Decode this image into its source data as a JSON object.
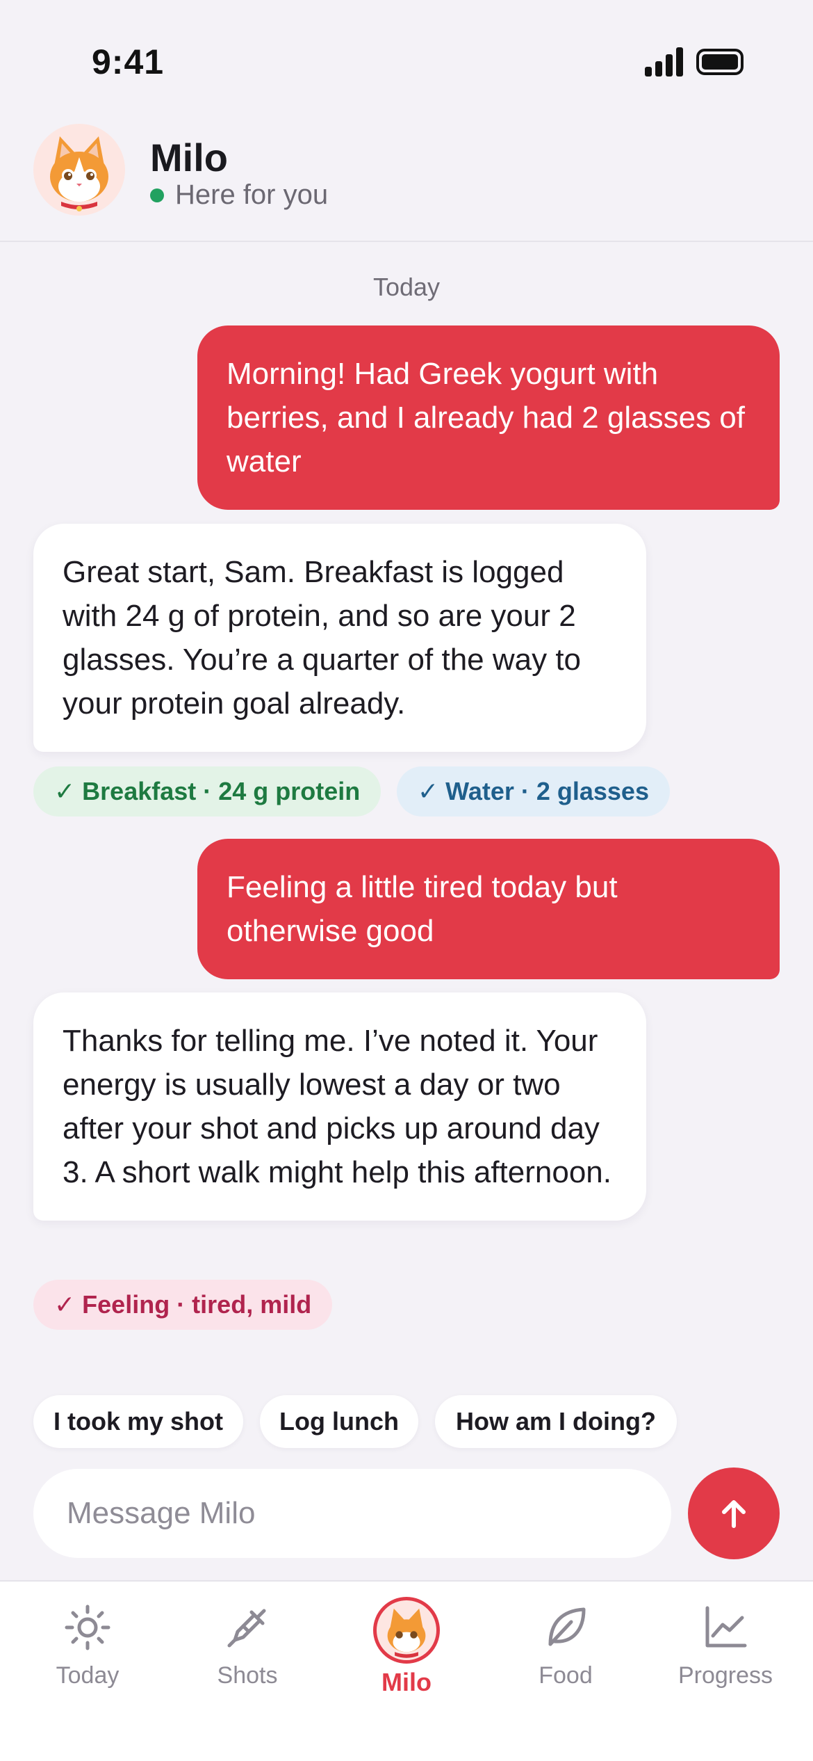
{
  "status_bar": {
    "time": "9:41"
  },
  "header": {
    "name": "Milo",
    "status": "Here for you"
  },
  "conversation": {
    "date_label": "Today",
    "messages": [
      {
        "role": "user",
        "text": "Morning! Had Greek yogurt with berries, and I already had 2 glasses of water"
      },
      {
        "role": "assistant",
        "text": "Great start, Sam. Breakfast is logged with 24 g of protein, and so are your 2 glasses. You’re a quarter of the way to your protein goal already."
      },
      {
        "role": "user",
        "text": "Feeling a little tired today but otherwise good"
      },
      {
        "role": "assistant",
        "text": "Thanks for telling me. I’ve noted it. Your energy is usually lowest a day or two after your shot and picks up around day 3. A short walk might help this afternoon."
      }
    ],
    "log_chips": [
      {
        "check": "✓",
        "label": "Breakfast · 24 g protein"
      },
      {
        "check": "✓",
        "label": "Water · 2 glasses"
      },
      {
        "check": "✓",
        "label": "Feeling · tired, mild"
      }
    ]
  },
  "quick_replies": [
    "I took my shot",
    "Log lunch",
    "How am I doing?"
  ],
  "composer": {
    "placeholder": "Message Milo"
  },
  "tab_bar": {
    "tabs": [
      {
        "label": "Today",
        "icon": "sun-icon"
      },
      {
        "label": "Shots",
        "icon": "syringe-icon"
      },
      {
        "label": "Milo",
        "icon": "cat-avatar",
        "active": true
      },
      {
        "label": "Food",
        "icon": "leaf-icon"
      },
      {
        "label": "Progress",
        "icon": "chart-icon"
      }
    ]
  },
  "colors": {
    "accent": "#e23a48",
    "background": "#f4f2f7",
    "online": "#22a160",
    "chip_green": "#1e7a41",
    "chip_blue": "#1f5f8c",
    "chip_pink": "#b0244e"
  }
}
